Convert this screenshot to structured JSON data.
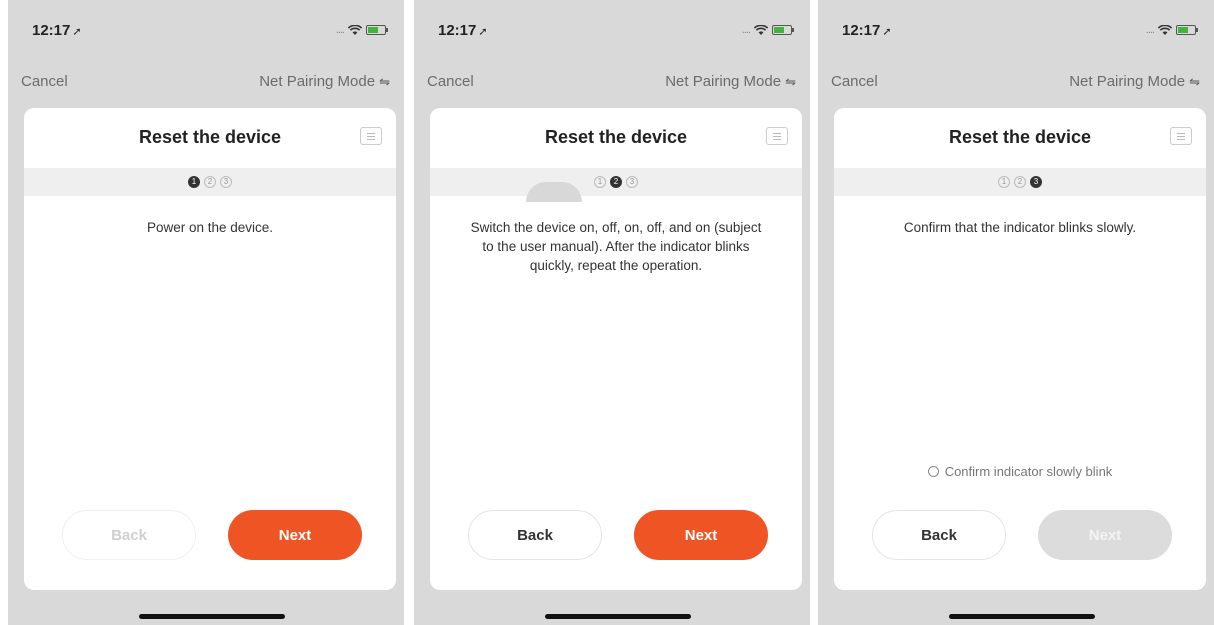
{
  "status": {
    "time": "12:17",
    "location_icon": "location-arrow-icon",
    "signal_text": "....",
    "wifi_icon": "wifi-icon",
    "battery_icon": "battery-icon",
    "battery_color": "#3cb73c"
  },
  "nav": {
    "cancel_label": "Cancel",
    "mode_label": "Net Pairing Mode",
    "mode_icon": "swap-arrows-icon"
  },
  "colors": {
    "accent": "#ef5424",
    "background": "#d9d9d9",
    "disabled_button": "#dcdcdc"
  },
  "screens": [
    {
      "title": "Reset the device",
      "active_step": 1,
      "steps": [
        "1",
        "2",
        "3"
      ],
      "instruction": "Power on the device.",
      "back_label": "Back",
      "back_enabled": false,
      "next_label": "Next",
      "next_enabled": true
    },
    {
      "title": "Reset the device",
      "active_step": 2,
      "steps": [
        "1",
        "2",
        "3"
      ],
      "instruction": "Switch the device on, off, on, off, and on (subject to the user manual). After the indicator blinks quickly, repeat the operation.",
      "back_label": "Back",
      "back_enabled": true,
      "next_label": "Next",
      "next_enabled": true
    },
    {
      "title": "Reset the device",
      "active_step": 3,
      "steps": [
        "1",
        "2",
        "3"
      ],
      "instruction": "Confirm that the indicator blinks slowly.",
      "confirm_label": "Confirm indicator slowly blink",
      "confirm_checked": false,
      "back_label": "Back",
      "back_enabled": true,
      "next_label": "Next",
      "next_enabled": false
    }
  ]
}
